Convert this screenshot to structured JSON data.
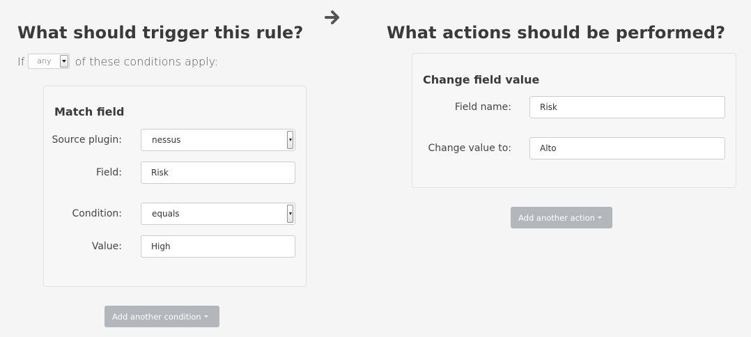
{
  "trigger": {
    "heading": "What should trigger this rule?",
    "if_word": "If",
    "match_select": {
      "value": "any"
    },
    "suffix": "of these conditions apply:",
    "condition": {
      "title": "Match field",
      "source_plugin": {
        "label": "Source plugin:",
        "value": "nessus"
      },
      "field": {
        "label": "Field:",
        "value": "Risk"
      },
      "condition": {
        "label": "Condition:",
        "value": "equals"
      },
      "value": {
        "label": "Value:",
        "value": "High"
      }
    },
    "add_button": "Add another condition"
  },
  "actions": {
    "heading": "What actions should be performed?",
    "action": {
      "title": "Change field value",
      "field_name": {
        "label": "Field name:",
        "value": "Risk"
      },
      "change_to": {
        "label": "Change value to:",
        "value": "Alto"
      }
    },
    "add_button": "Add another action"
  },
  "icons": {
    "arrow": "arrow-right-icon",
    "dropdown": "chevron-down-icon"
  },
  "colors": {
    "background": "#f5f5f5",
    "panel": "#f7f7f7",
    "button": "#b3b6ba",
    "heading": "#3a3a3a"
  }
}
